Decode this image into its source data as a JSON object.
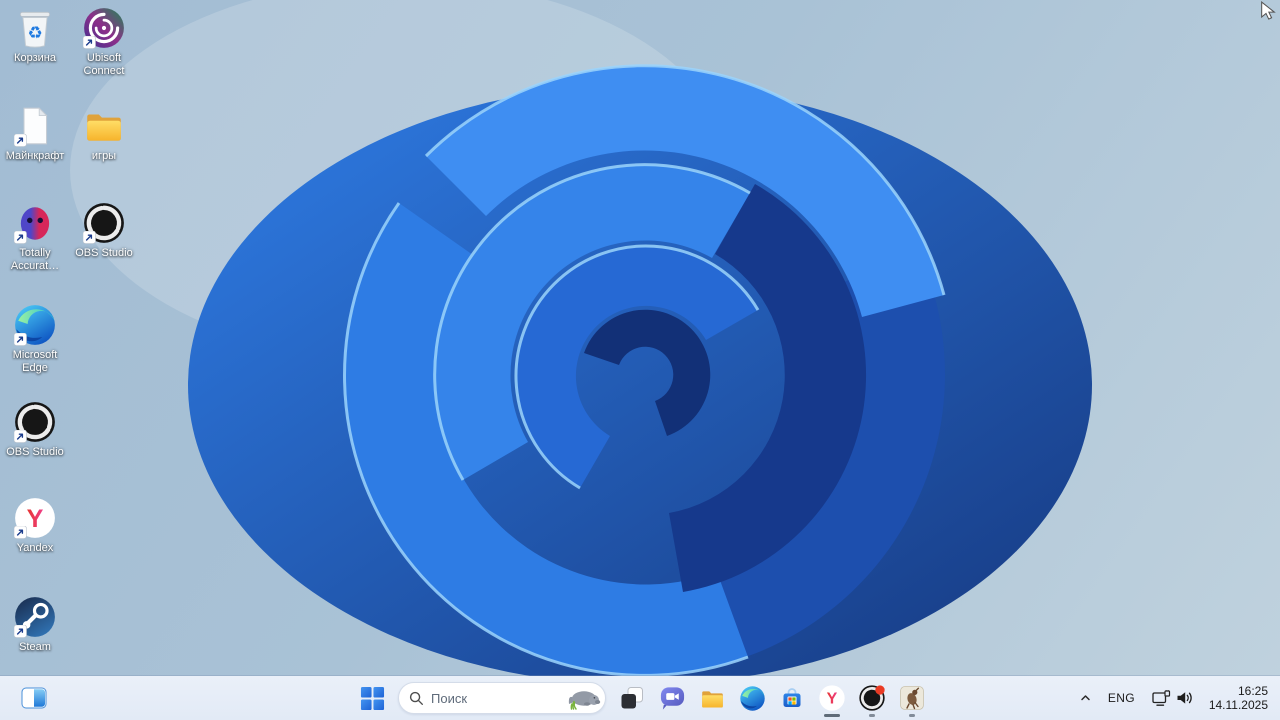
{
  "wallpaper": {
    "name": "windows-11-bloom",
    "description": "blue ribbon flower on light blue background"
  },
  "desktop": {
    "icons": [
      {
        "label": "Корзина",
        "name": "recycle-bin",
        "shortcut_arrow": false
      },
      {
        "label": "Ubisoft Connect",
        "name": "ubisoft-connect",
        "shortcut_arrow": true
      },
      {
        "label": "Майнкрафт",
        "name": "minecraft",
        "shortcut_arrow": true
      },
      {
        "label": "игры",
        "name": "games-folder",
        "shortcut_arrow": false
      },
      {
        "label": "Totally Accurat…",
        "name": "totally-accurate-battle-simulator",
        "shortcut_arrow": true
      },
      {
        "label": "OBS Studio",
        "name": "obs-studio",
        "shortcut_arrow": true
      },
      {
        "label": "Microsoft Edge",
        "name": "microsoft-edge",
        "shortcut_arrow": true
      },
      {
        "label": "OBS Studio",
        "name": "obs-studio-2",
        "shortcut_arrow": true
      },
      {
        "label": "Yandex",
        "name": "yandex-browser",
        "shortcut_arrow": true
      },
      {
        "label": "Steam",
        "name": "steam",
        "shortcut_arrow": true
      }
    ]
  },
  "taskbar": {
    "widgets_icon": "widgets-board-icon",
    "start_icon": "windows-start-icon",
    "search": {
      "placeholder": "Поиск",
      "icon": "search-icon",
      "highlight_image": "manatee-search-highlight"
    },
    "buttons": [
      {
        "name": "task-view",
        "running": false
      },
      {
        "name": "chat-teams",
        "running": false
      },
      {
        "name": "file-explorer",
        "running": false
      },
      {
        "name": "microsoft-edge",
        "running": false
      },
      {
        "name": "microsoft-store",
        "running": false
      },
      {
        "name": "yandex-browser",
        "running": true,
        "active": true
      },
      {
        "name": "obs-studio",
        "running": true,
        "notification_badge": true
      },
      {
        "name": "game-window",
        "running": true
      }
    ],
    "tray": {
      "language": "ENG",
      "time": "16:25",
      "date": "14.11.2025"
    }
  },
  "colors": {
    "wallpaper_top": "#a2bcd3",
    "wallpaper_bottom": "#c0d2de",
    "flower_bright": "#2e7ce4",
    "flower_dark": "#16398c",
    "taskbar_bg": "#e6edf8",
    "start_blue": "#2f7ce4",
    "notification_red": "#ea3b24"
  }
}
